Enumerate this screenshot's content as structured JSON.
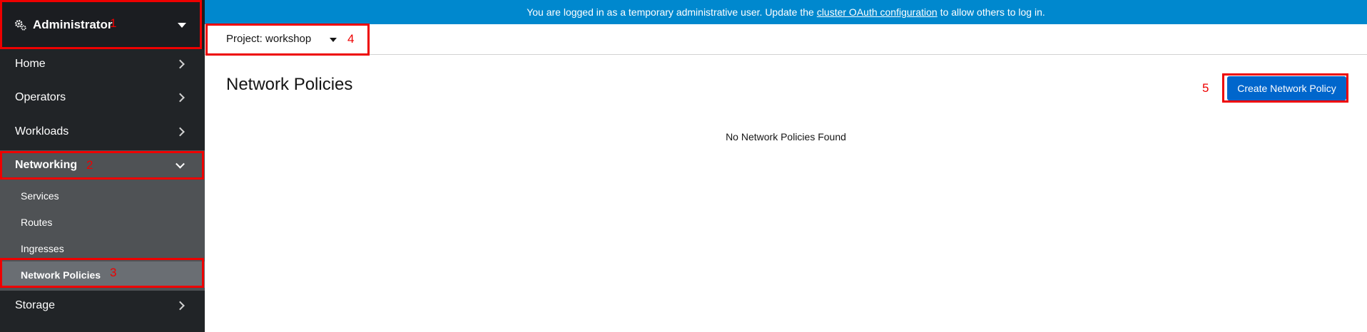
{
  "sidebar": {
    "perspective": "Administrator",
    "nav": [
      {
        "label": "Home"
      },
      {
        "label": "Operators"
      },
      {
        "label": "Workloads"
      },
      {
        "label": "Networking"
      },
      {
        "label": "Storage"
      }
    ],
    "networking_items": [
      {
        "label": "Services"
      },
      {
        "label": "Routes"
      },
      {
        "label": "Ingresses"
      },
      {
        "label": "Network Policies"
      }
    ]
  },
  "banner": {
    "text_before": "You are logged in as a temporary administrative user. Update the",
    "link": "cluster OAuth configuration",
    "text_after": "to allow others to log in."
  },
  "project_selector": {
    "label": "Project: workshop"
  },
  "page": {
    "title": "Network Policies",
    "create_button": "Create Network Policy",
    "empty_message": "No Network Policies Found"
  },
  "annotations": [
    "1",
    "2",
    "3",
    "4",
    "5"
  ],
  "colors": {
    "annotation": "#ee0000",
    "banner": "#0088ce",
    "primary_button": "#0066cc",
    "sidebar_bg": "#212427"
  }
}
